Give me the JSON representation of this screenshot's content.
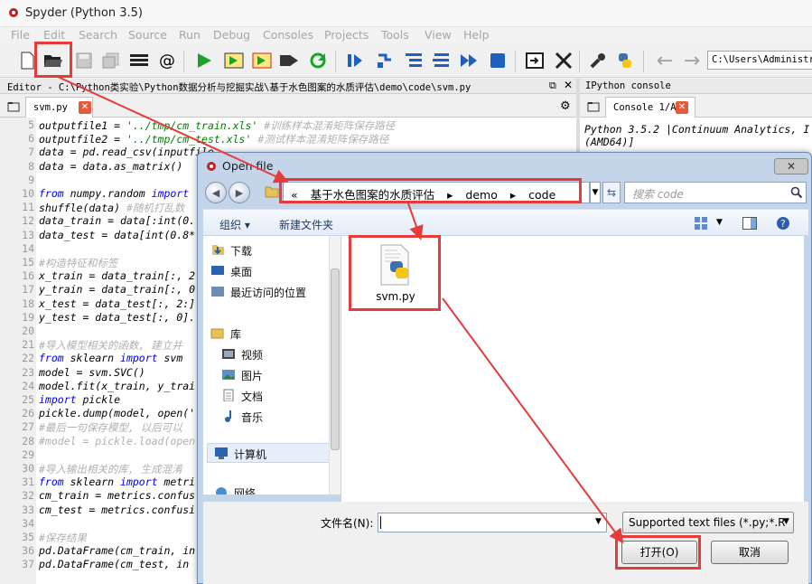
{
  "app": {
    "title": "Spyder (Python 3.5)"
  },
  "menu": [
    "File",
    "Edit",
    "Search",
    "Source",
    "Run",
    "Debug",
    "Consoles",
    "Projects",
    "Tools",
    "View",
    "Help"
  ],
  "toolbar": {
    "path": "C:\\Users\\Administrator"
  },
  "editor": {
    "header": "Editor - C:\\Python类实验\\Python数据分析与挖掘实战\\基于水色图案的水质评估\\demo\\code\\svm.py",
    "tab": "svm.py",
    "lines": [
      {
        "n": "5",
        "code": "outputfile1 = '../tmp/cm_train.xls' #训练样本混淆矩阵保存路径"
      },
      {
        "n": "6",
        "code": "outputfile2 = '../tmp/cm_test.xls' #测试样本混淆矩阵保存路径"
      },
      {
        "n": "7",
        "code": "data = pd.read_csv(inputfile"
      },
      {
        "n": "8",
        "code": "data = data.as_matrix()"
      },
      {
        "n": "9",
        "code": ""
      },
      {
        "n": "10",
        "code": "from numpy.random import"
      },
      {
        "n": "11",
        "code": "shuffle(data) #随机打乱数"
      },
      {
        "n": "12",
        "code": "data_train = data[:int(0."
      },
      {
        "n": "13",
        "code": "data_test = data[int(0.8*"
      },
      {
        "n": "14",
        "code": ""
      },
      {
        "n": "15",
        "code": "#构造特征和标签"
      },
      {
        "n": "16",
        "code": "x_train = data_train[:, 2"
      },
      {
        "n": "17",
        "code": "y_train = data_train[:, 0"
      },
      {
        "n": "18",
        "code": "x_test = data_test[:, 2:]"
      },
      {
        "n": "19",
        "code": "y_test = data_test[:, 0]."
      },
      {
        "n": "20",
        "code": ""
      },
      {
        "n": "21",
        "code": "#导入模型相关的函数, 建立并"
      },
      {
        "n": "22",
        "code": "from sklearn import svm"
      },
      {
        "n": "23",
        "code": "model = svm.SVC()"
      },
      {
        "n": "24",
        "code": "model.fit(x_train, y_trai"
      },
      {
        "n": "25",
        "code": "import pickle"
      },
      {
        "n": "26",
        "code": "pickle.dump(model, open('"
      },
      {
        "n": "27",
        "code": "#最后一句保存模型, 以后可以"
      },
      {
        "n": "28",
        "code": "#model = pickle.load(open"
      },
      {
        "n": "29",
        "code": ""
      },
      {
        "n": "30",
        "code": "#导入输出相关的库, 生成混淆"
      },
      {
        "n": "31",
        "code": "from sklearn import metri"
      },
      {
        "n": "32",
        "code": "cm_train = metrics.confus"
      },
      {
        "n": "33",
        "code": "cm_test = metrics.confusi"
      },
      {
        "n": "34",
        "code": ""
      },
      {
        "n": "35",
        "code": "#保存结果"
      },
      {
        "n": "36",
        "code": "pd.DataFrame(cm_train, in"
      },
      {
        "n": "37",
        "code": "pd.DataFrame(cm_test, in"
      }
    ]
  },
  "console": {
    "header": "IPython console",
    "tab": "Console 1/A",
    "line1": "Python 3.5.2 |Continuum Analytics, I",
    "line2": "(AMD64)]"
  },
  "dialog": {
    "title": "Open file",
    "close": "✕",
    "breadcrumb": [
      "«",
      "基于水色图案的水质评估",
      "▸",
      "demo",
      "▸",
      "code"
    ],
    "search_placeholder": "搜索 code",
    "organize": "组织 ▾",
    "new_folder": "新建文件夹",
    "nav": {
      "downloads": "下载",
      "desktop": "桌面",
      "recent": "最近访问的位置",
      "libraries": "库",
      "videos": "视频",
      "pictures": "图片",
      "documents": "文档",
      "music": "音乐",
      "computer": "计算机",
      "network": "网络"
    },
    "file": "svm.py",
    "filename_label": "文件名(N):",
    "filename_value": "",
    "filetype": "Supported text files (*.py;*.R",
    "open_label": "打开(O)",
    "cancel_label": "取消"
  }
}
